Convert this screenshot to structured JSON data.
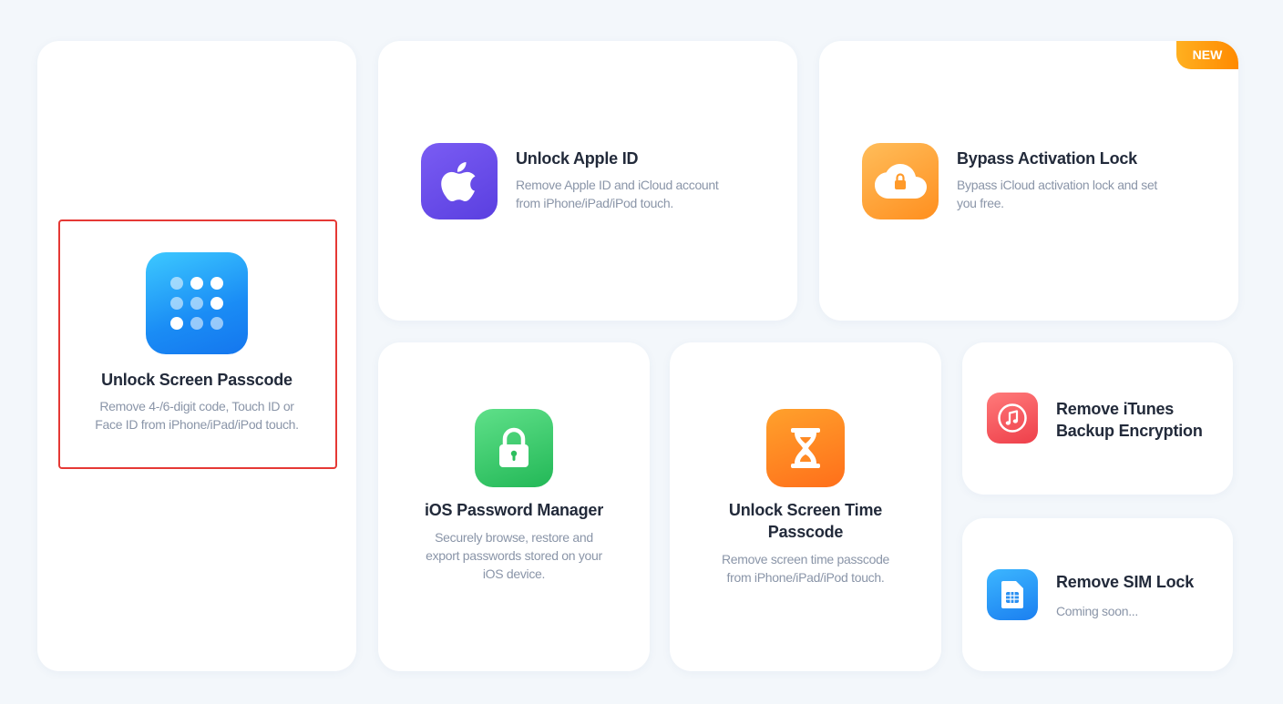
{
  "cards": {
    "unlock_screen_passcode": {
      "title": "Unlock Screen Passcode",
      "desc_line1": "Remove 4-/6-digit code, Touch ID or",
      "desc_line2": "Face ID from iPhone/iPad/iPod touch.",
      "icon": "keypad-icon"
    },
    "unlock_apple_id": {
      "title": "Unlock Apple ID",
      "desc_line1": "Remove Apple ID and iCloud account",
      "desc_line2": "from iPhone/iPad/iPod touch.",
      "icon": "apple-icon"
    },
    "bypass_activation_lock": {
      "title": "Bypass Activation Lock",
      "desc_line1": "Bypass iCloud activation lock and set",
      "desc_line2": "you free.",
      "badge": "NEW",
      "icon": "cloud-lock-icon"
    },
    "ios_password_manager": {
      "title": "iOS Password Manager",
      "desc_line1": "Securely browse, restore and",
      "desc_line2": "export passwords stored on your",
      "desc_line3": "iOS device.",
      "icon": "padlock-icon"
    },
    "unlock_screen_time": {
      "title_line1": "Unlock Screen Time",
      "title_line2": "Passcode",
      "desc_line1": "Remove screen time passcode",
      "desc_line2": "from iPhone/iPad/iPod touch.",
      "icon": "hourglass-icon"
    },
    "remove_itunes_backup": {
      "title_line1": "Remove iTunes",
      "title_line2": "Backup Encryption",
      "icon": "music-note-icon"
    },
    "remove_sim_lock": {
      "title": "Remove SIM Lock",
      "status": "Coming soon...",
      "icon": "sim-card-icon"
    }
  },
  "colors": {
    "selection_border": "#e53935",
    "badge": "#ff9a10",
    "background": "#f3f7fb"
  },
  "selected_card": "unlock_screen_passcode"
}
